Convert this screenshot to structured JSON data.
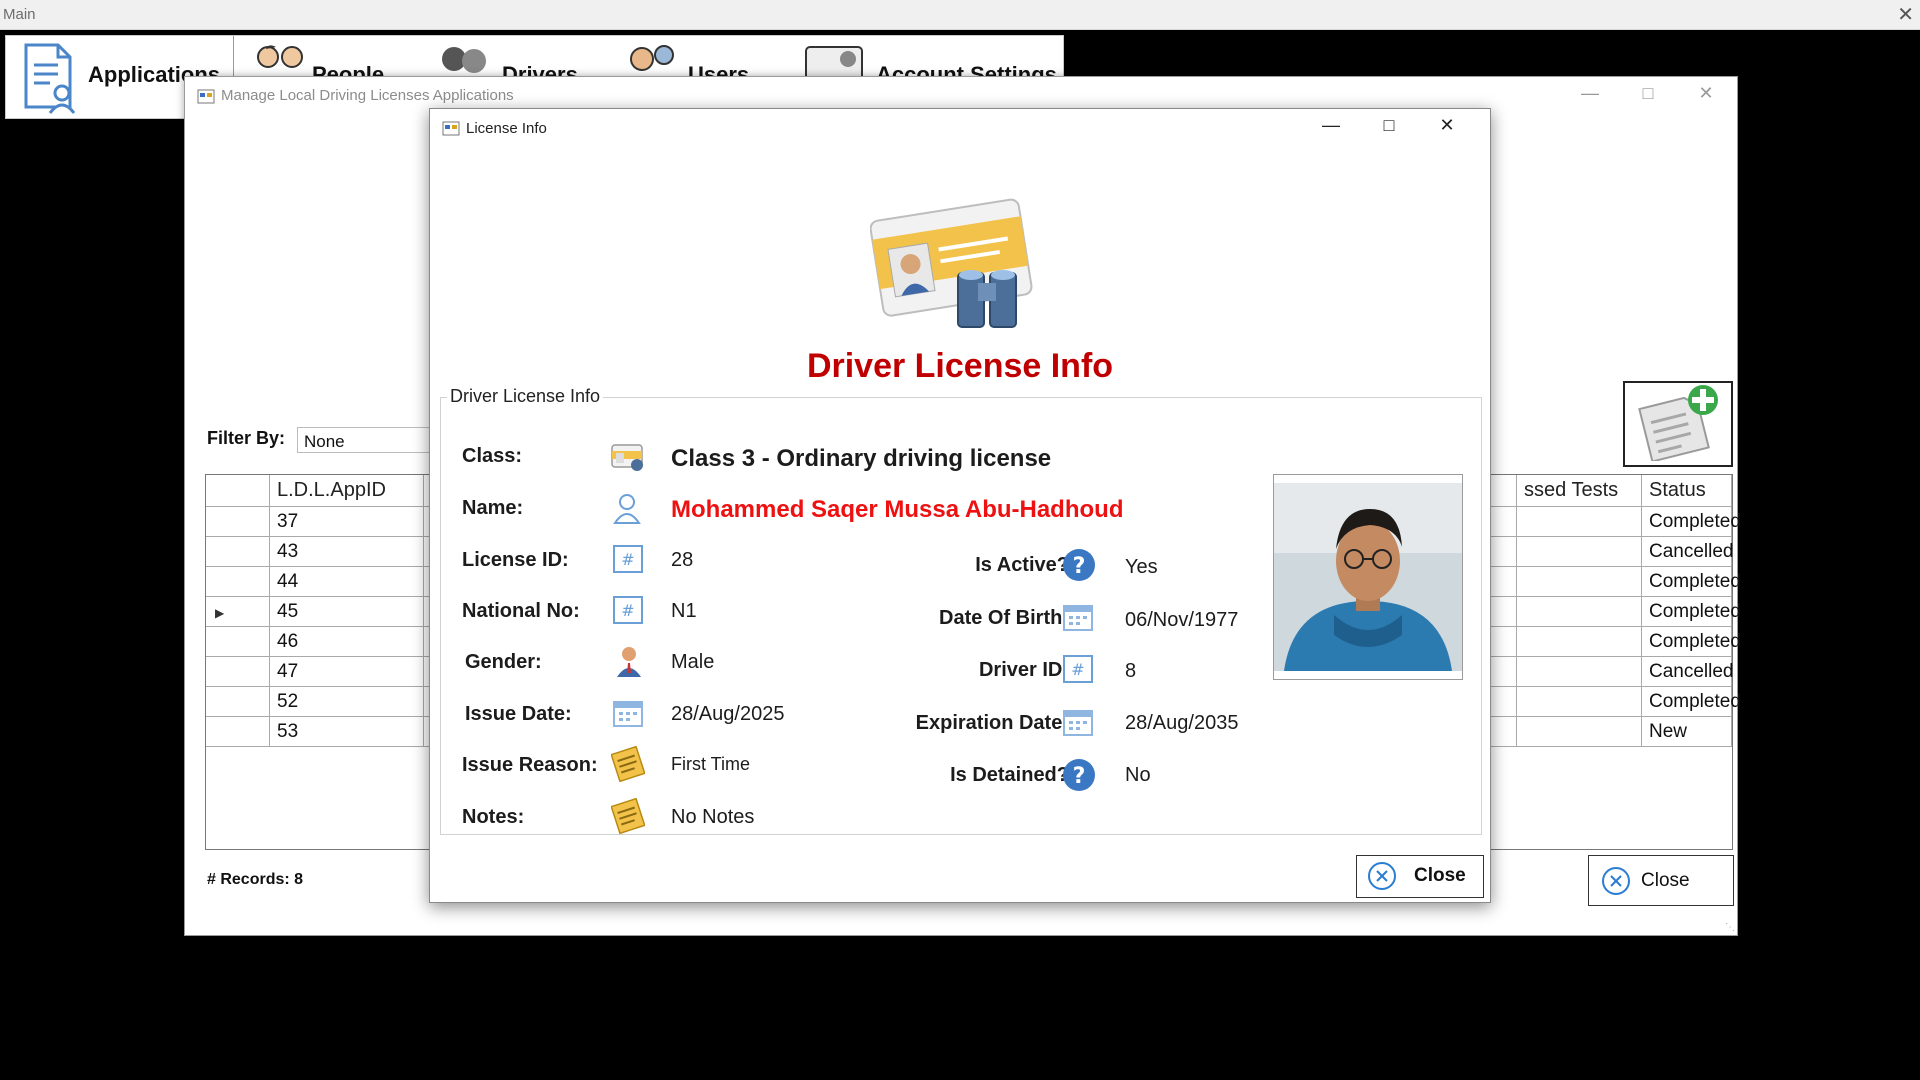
{
  "main": {
    "title": "Main",
    "menu": [
      {
        "label": "Applications"
      },
      {
        "label": "People"
      },
      {
        "label": "Drivers"
      },
      {
        "label": "Users"
      },
      {
        "label": "Account Settings"
      }
    ]
  },
  "manage": {
    "title": "Manage Local Driving Licenses Applications",
    "filter_label": "Filter By:",
    "filter_value": "None",
    "columns": [
      "L.D.L.AppID",
      "ssed Tests",
      "Status"
    ],
    "rows": [
      {
        "id": "37",
        "status": "Completed"
      },
      {
        "id": "43",
        "status": "Cancelled"
      },
      {
        "id": "44",
        "status": "Completed"
      },
      {
        "id": "45",
        "status": "Completed"
      },
      {
        "id": "46",
        "status": "Completed"
      },
      {
        "id": "47",
        "status": "Cancelled"
      },
      {
        "id": "52",
        "status": "Completed"
      },
      {
        "id": "53",
        "status": "New"
      }
    ],
    "records_label": "# Records:",
    "records_count": "8",
    "close_label": "Close"
  },
  "dialog": {
    "title": "License Info",
    "heading": "Driver License Info",
    "group_title": "Driver License Info",
    "labels": {
      "class": "Class:",
      "name": "Name:",
      "license_id": "License ID:",
      "national_no": "National No:",
      "gender": "Gender:",
      "issue_date": "Issue Date:",
      "issue_reason": "Issue Reason:",
      "notes": "Notes:",
      "is_active": "Is Active?",
      "date_of_birth": "Date Of Birth:",
      "driver_id": "Driver ID:",
      "expiration_date": "Expiration Date:",
      "is_detained": "Is Detained?"
    },
    "values": {
      "class": "Class 3 - Ordinary driving license",
      "name": "Mohammed Saqer Mussa Abu-Hadhoud",
      "license_id": "28",
      "national_no": "N1",
      "gender": "Male",
      "issue_date": "28/Aug/2025",
      "issue_reason": "First Time",
      "notes": "No Notes",
      "is_active": "Yes",
      "date_of_birth": "06/Nov/1977",
      "driver_id": "8",
      "expiration_date": "28/Aug/2035",
      "is_detained": "No"
    },
    "close_label": "Close"
  },
  "colors": {
    "heading": "#c00000",
    "name_value": "#ee1111",
    "help_icon": "#3a78c3"
  },
  "icons": [
    "applications-icon",
    "people-icon",
    "drivers-icon",
    "users-icon",
    "account-settings-icon",
    "license-card-icon",
    "add-application-icon",
    "close-circle-icon",
    "help-icon",
    "calendar-icon",
    "hash-icon",
    "person-outline-icon",
    "person-icon",
    "notes-icon"
  ]
}
